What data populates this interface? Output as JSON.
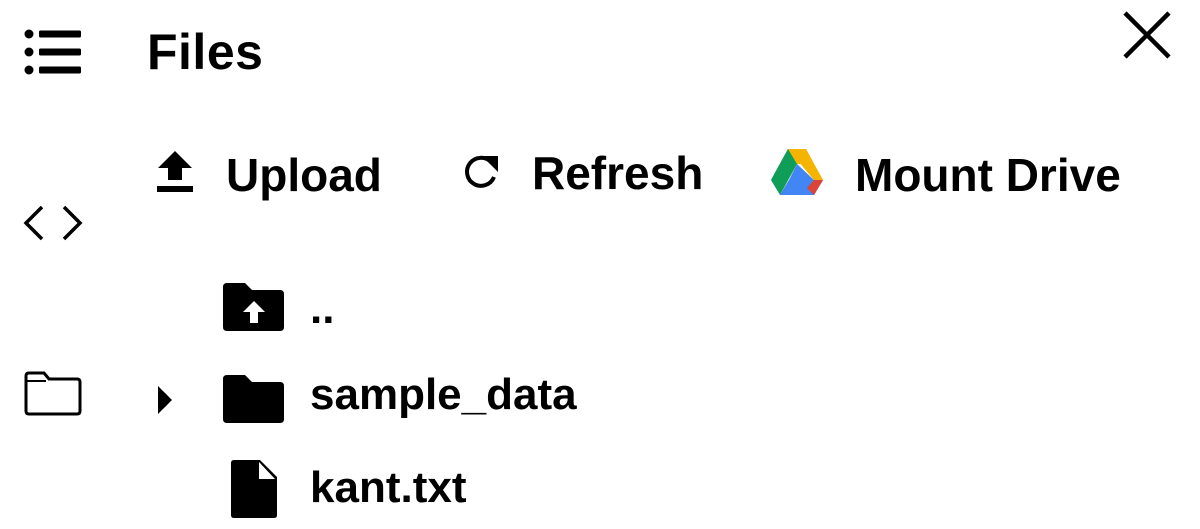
{
  "panel": {
    "title": "Files"
  },
  "sidebar": {
    "items": [
      {
        "icon": "menu-list-icon"
      },
      {
        "icon": "code-brackets-icon"
      },
      {
        "icon": "folder-outline-icon"
      }
    ]
  },
  "toolbar": {
    "upload_label": "Upload",
    "refresh_label": "Refresh",
    "mount_drive_label": "Mount Drive"
  },
  "file_tree": {
    "items": [
      {
        "name": "..",
        "type": "parent-folder",
        "icon": "folder-upload-icon"
      },
      {
        "name": "sample_data",
        "type": "folder",
        "icon": "folder-icon",
        "expandable": true,
        "expanded": false
      },
      {
        "name": "kant.txt",
        "type": "file",
        "icon": "file-icon"
      }
    ]
  },
  "colors": {
    "text": "#000000",
    "background": "#ffffff",
    "drive_green": "#0F9D58",
    "drive_yellow": "#F4B400",
    "drive_blue": "#4285F4",
    "drive_red": "#DB4437"
  }
}
